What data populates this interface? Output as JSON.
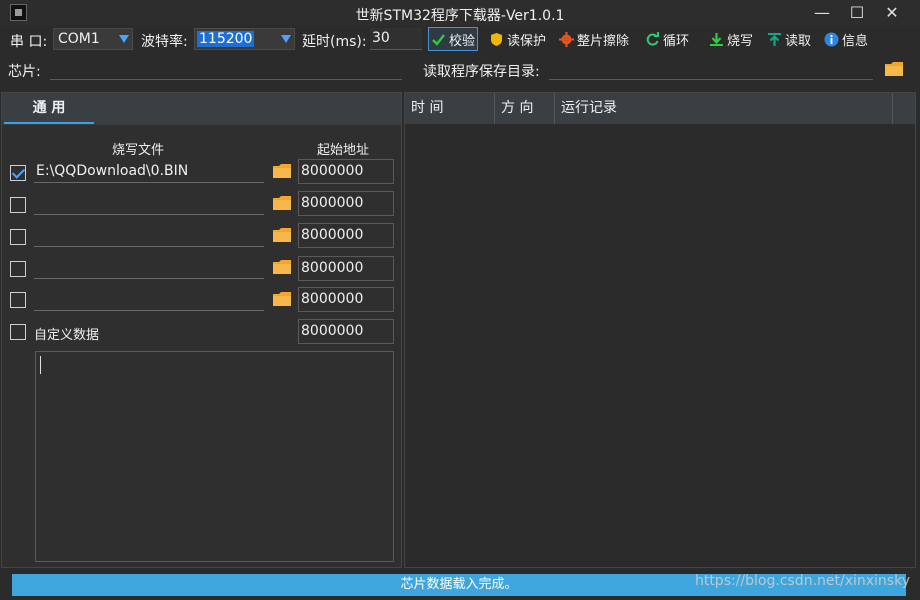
{
  "window": {
    "title": "世新STM32程序下载器-Ver1.0.1",
    "minimize": "—",
    "maximize": "☐",
    "close": "✕"
  },
  "toolbar": {
    "port_label": "串 口:",
    "port_value": "COM1",
    "baud_label": "波特率:",
    "baud_value": "115200",
    "delay_label": "延时(ms):",
    "delay_value": "30",
    "verify": "校验",
    "read_protect": "读保护",
    "full_erase": "整片擦除",
    "loop": "循环",
    "burn": "烧写",
    "read": "读取",
    "info": "信息"
  },
  "chip_row": {
    "chip_label": "芯片:",
    "save_dir_label": "读取程序保存目录:"
  },
  "left": {
    "tab": "通 用",
    "col_file": "烧写文件",
    "col_addr": "起始地址",
    "rows": [
      {
        "checked": true,
        "file": "E:\\QQDownload\\0.BIN",
        "addr": "8000000"
      },
      {
        "checked": false,
        "file": "",
        "addr": "8000000"
      },
      {
        "checked": false,
        "file": "",
        "addr": "8000000"
      },
      {
        "checked": false,
        "file": "",
        "addr": "8000000"
      },
      {
        "checked": false,
        "file": "",
        "addr": "8000000"
      }
    ],
    "custom_label": "自定义数据",
    "custom_addr": "8000000"
  },
  "right": {
    "columns": [
      "时 间",
      "方 向",
      "运行记录"
    ]
  },
  "status": {
    "text": "芯片数据载入完成。"
  },
  "watermark": "https://blog.csdn.net/xinxinsky",
  "colors": {
    "accent": "#3aa0ea",
    "status_bar": "#3fa5dd",
    "selection": "#1e6fd4"
  }
}
